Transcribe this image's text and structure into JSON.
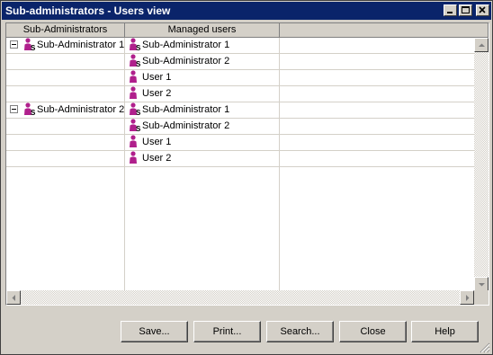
{
  "window": {
    "title": "Sub-administrators - Users view"
  },
  "columns": [
    "Sub-Administrators",
    "Managed users",
    ""
  ],
  "groups": [
    {
      "admin": "Sub-Administrator 1",
      "managed": [
        {
          "label": "Sub-Administrator 1",
          "icon": "subadmin-icon"
        },
        {
          "label": "Sub-Administrator 2",
          "icon": "subadmin-icon"
        },
        {
          "label": "User 1",
          "icon": "user-icon"
        },
        {
          "label": "User 2",
          "icon": "user-icon"
        }
      ]
    },
    {
      "admin": "Sub-Administrator 2",
      "managed": [
        {
          "label": "Sub-Administrator 1",
          "icon": "subadmin-icon"
        },
        {
          "label": "Sub-Administrator 2",
          "icon": "subadmin-icon"
        },
        {
          "label": "User 1",
          "icon": "user-icon"
        },
        {
          "label": "User 2",
          "icon": "user-icon"
        }
      ]
    }
  ],
  "buttons": {
    "save": "Save...",
    "print": "Print...",
    "search": "Search...",
    "close": "Close",
    "help": "Help"
  },
  "colors": {
    "titlebar": "#0a246a",
    "user_icon": "#b0208c"
  }
}
